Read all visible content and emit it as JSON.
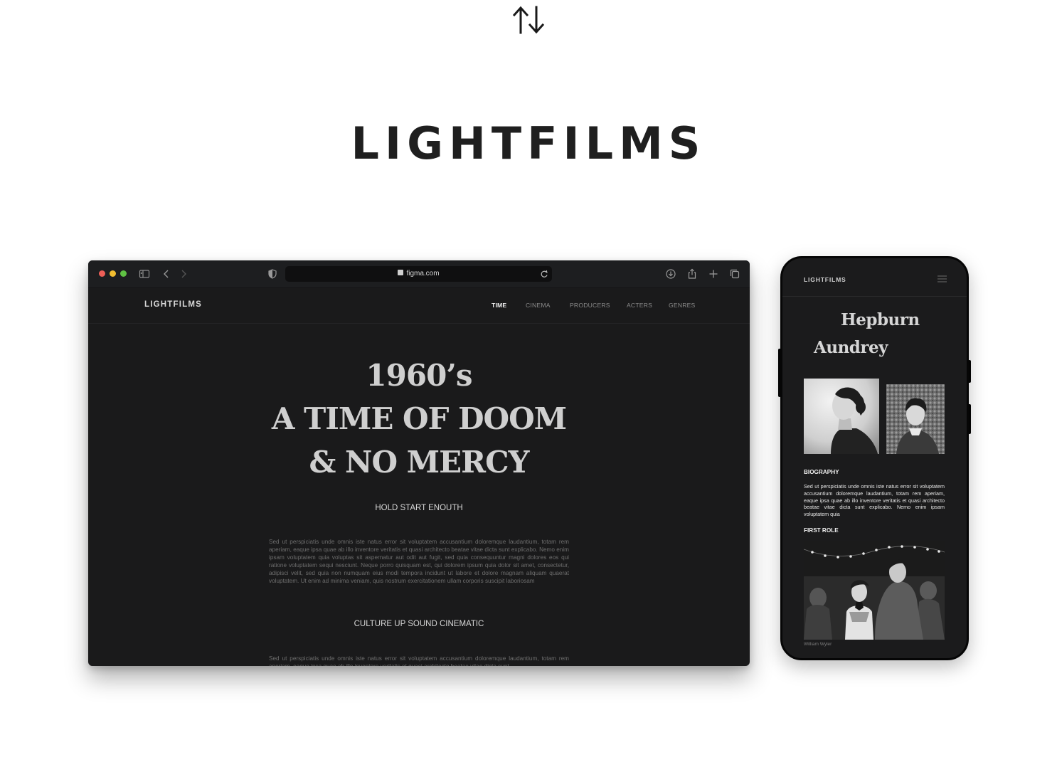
{
  "page": {
    "brand_title": "LIGHTFILMS",
    "top_icon": "swap-vertical-arrows-icon"
  },
  "browser": {
    "url": "figma.com",
    "icons": [
      "sidebar-icon",
      "back-icon",
      "forward-icon",
      "shield-icon",
      "lock-icon",
      "reload-icon",
      "download-icon",
      "share-icon",
      "new-tab-icon",
      "tabs-icon"
    ],
    "site": {
      "logo": "LIGHTFILMS",
      "nav": [
        {
          "label": "TIME",
          "active": true
        },
        {
          "label": "CINEMA",
          "active": false
        },
        {
          "label": "PRODUCERS",
          "active": false
        },
        {
          "label": "ACTERS",
          "active": false
        },
        {
          "label": "GENRES",
          "active": false
        }
      ],
      "hero": {
        "line1": "1960’s",
        "line2": "A TIME OF DOOM",
        "line3": "& NO MERCY"
      },
      "section1": {
        "title": "HOLD START ENOUTH",
        "text": "Sed ut perspiciatis unde omnis iste natus error sit voluptatem accusantium doloremque laudantium, totam rem aperiam, eaque ipsa quae ab illo inventore veritatis et quasi architecto beatae vitae dicta sunt explicabo. Nemo enim ipsam voluptatem quia voluptas sit aspernatur aut odit aut fugit, sed quia consequuntur magni dolores eos qui ratione voluptatem sequi nesciunt. Neque porro quisquam est, qui dolorem ipsum quia dolor sit amet, consectetur, adipisci velit, sed quia non numquam eius modi tempora incidunt ut labore et dolore magnam aliquam quaerat voluptatem. Ut enim ad minima veniam, quis nostrum exercitationem ullam corporis suscipit laboriosam"
      },
      "section2": {
        "title": "CULTURE UP SOUND CINEMATIC",
        "text": "Sed ut perspiciatis unde omnis iste natus error sit voluptatem accusantium doloremque laudantium, totam rem aperiam, eaque ipsa quae ab illo inventore veritatis et quasi architecto beatae vitae dicta sunt"
      }
    }
  },
  "phone": {
    "logo": "LIGHTFILMS",
    "menu_icon": "hamburger-menu-icon",
    "name_line1": "Hepburn",
    "name_line2": "Aundrey",
    "biography": {
      "heading": "BIOGRAPHY",
      "text": "Sed ut perspiciatis unde omnis iste natus error sit voluptatem accusantium doloremque laudantium, totam rem aperiam, eaque ipsa quae ab illo inventore veritatis et quasi architecto beatae vitae dicta sunt explicabo. Nemo enim ipsam voluptatem quia"
    },
    "first_role": {
      "heading": "FIRST ROLE",
      "caption": "William Wyler"
    }
  }
}
